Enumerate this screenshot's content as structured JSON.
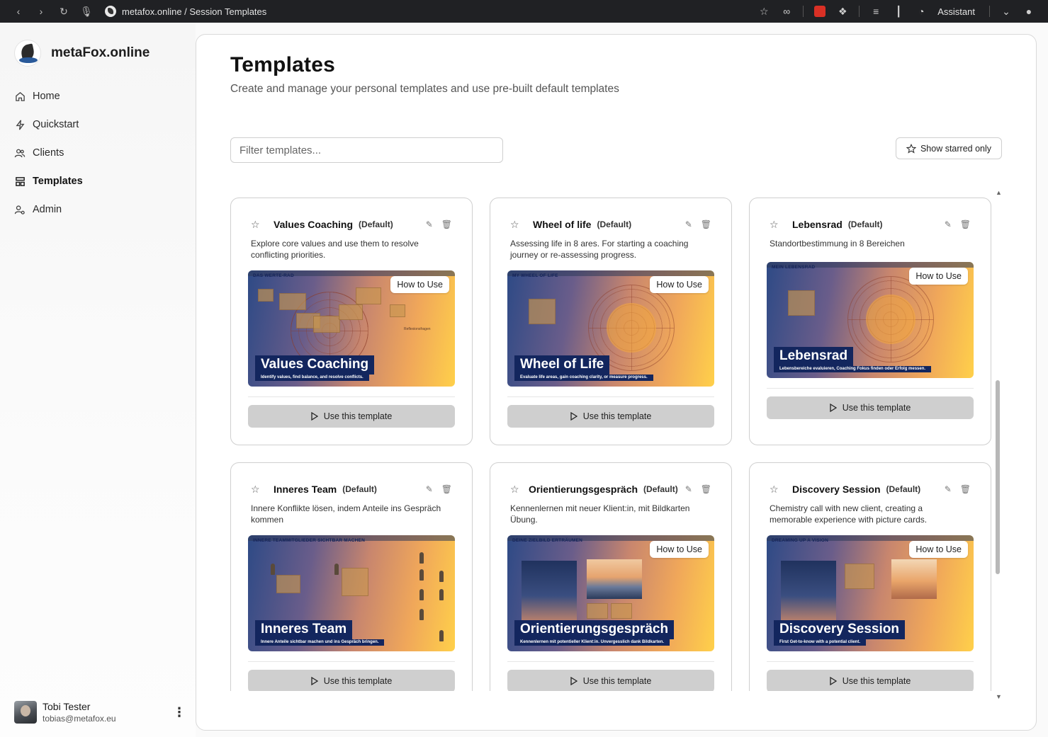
{
  "browser": {
    "url_text": "metafox.online / Session Templates",
    "assistant_label": "Assistant"
  },
  "sidebar": {
    "brand": "metaFox.online",
    "items": [
      {
        "label": "Home",
        "icon": "home-icon"
      },
      {
        "label": "Quickstart",
        "icon": "bolt-icon"
      },
      {
        "label": "Clients",
        "icon": "users-icon"
      },
      {
        "label": "Templates",
        "icon": "templates-icon",
        "active": true
      },
      {
        "label": "Admin",
        "icon": "admin-icon"
      }
    ],
    "user": {
      "name": "Tobi Tester",
      "email": "tobias@metafox.eu"
    }
  },
  "main": {
    "title": "Templates",
    "subtitle": "Create and manage your personal templates and use pre-built default templates",
    "filter_placeholder": "Filter templates...",
    "starred_label": "Show starred only",
    "use_label": "Use this template",
    "how_to_label": "How to Use",
    "default_tag": "(Default)",
    "templates": [
      {
        "title": "Values Coaching",
        "description": "Explore core values and use them to resolve conflicting priorities.",
        "thumb_header": "DAS WERTE-RAD",
        "thumb_title": "Values Coaching",
        "thumb_caption": "Identify values, find balance, and resolve conflicts."
      },
      {
        "title": "Wheel of life",
        "description": "Assessing life in 8 ares. For starting a coaching journey or re-assessing progress.",
        "thumb_header": "MY WHEEL OF LIFE",
        "thumb_title": "Wheel of Life",
        "thumb_caption": "Evaluate life areas, gain coaching clarity, or measure progress."
      },
      {
        "title": "Lebensrad",
        "description": "Standortbestimmung in 8 Bereichen",
        "thumb_header": "MEIN LEBENSRAD",
        "thumb_title": "Lebensrad",
        "thumb_caption": "Lebensbereiche evaluieren, Coaching Fokus finden oder Erfolg messen."
      },
      {
        "title": "Inneres Team",
        "description": "Innere Konflikte lösen, indem Anteile ins Gespräch kommen",
        "thumb_header": "INNERE TEAMMITGLIEDER SICHTBAR MACHEN",
        "thumb_title": "Inneres Team",
        "thumb_caption": "Innere Anteile sichtbar machen und ins Gespräch bringen."
      },
      {
        "title": "Orientierungsgespräch",
        "description": "Kennenlernen mit neuer Klient:in, mit Bildkarten Übung.",
        "thumb_header": "DEINE ZIELBILD ERTRÄUMEN",
        "thumb_title": "Orientierungsgespräch",
        "thumb_caption": "Kennenlernen mit potentieller Klient:in. Unvergesslich dank Bildkarten."
      },
      {
        "title": "Discovery Session",
        "description": "Chemistry call with new client, creating a memorable experience with picture cards.",
        "thumb_header": "DREAMING UP A VISION",
        "thumb_title": "Discovery Session",
        "thumb_caption": "First Get-to-know with a potential client."
      }
    ]
  }
}
